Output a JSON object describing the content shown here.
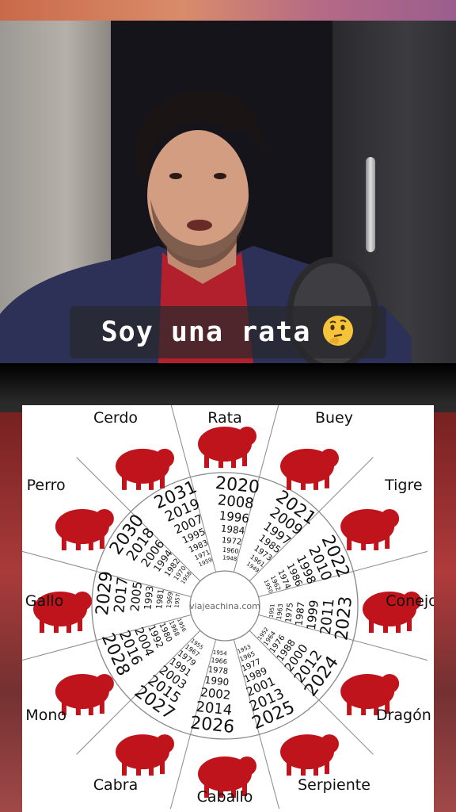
{
  "caption": {
    "text": "Soy una rata",
    "emoji": "thinking-face"
  },
  "watermark": "viajeachina.com",
  "colors": {
    "animal": "#c0141c",
    "ring": "#888888",
    "text": "#111111"
  },
  "animals": [
    {
      "name": "Rata",
      "years": [
        "2020",
        "2008",
        "1996",
        "1984",
        "1972",
        "1960",
        "1948"
      ]
    },
    {
      "name": "Buey",
      "years": [
        "2021",
        "2009",
        "1997",
        "1985",
        "1973",
        "1961",
        "1949"
      ]
    },
    {
      "name": "Tigre",
      "years": [
        "2022",
        "2010",
        "1998",
        "1986",
        "1974",
        "1962",
        "1950"
      ]
    },
    {
      "name": "Conejo",
      "years": [
        "2023",
        "2011",
        "1999",
        "1987",
        "1975",
        "1963",
        "1951"
      ]
    },
    {
      "name": "Dragón",
      "years": [
        "2024",
        "2012",
        "2000",
        "1988",
        "1976",
        "1964",
        "1952"
      ]
    },
    {
      "name": "Serpiente",
      "years": [
        "2025",
        "2013",
        "2001",
        "1989",
        "1977",
        "1965",
        "1953"
      ]
    },
    {
      "name": "Caballo",
      "years": [
        "2026",
        "2014",
        "2002",
        "1990",
        "1978",
        "1966",
        "1954"
      ]
    },
    {
      "name": "Cabra",
      "years": [
        "2027",
        "2015",
        "2003",
        "1991",
        "1979",
        "1967",
        "1955"
      ]
    },
    {
      "name": "Mono",
      "years": [
        "2028",
        "2016",
        "2004",
        "1992",
        "1980",
        "1968",
        "1956"
      ]
    },
    {
      "name": "Gallo",
      "years": [
        "2029",
        "2017",
        "2005",
        "1993",
        "1981",
        "1969",
        "1957"
      ]
    },
    {
      "name": "Perro",
      "years": [
        "2030",
        "2018",
        "2006",
        "1994",
        "1982",
        "1970",
        "1958"
      ]
    },
    {
      "name": "Cerdo",
      "years": [
        "2031",
        "2019",
        "2007",
        "1995",
        "1983",
        "1971",
        "1959"
      ]
    }
  ]
}
